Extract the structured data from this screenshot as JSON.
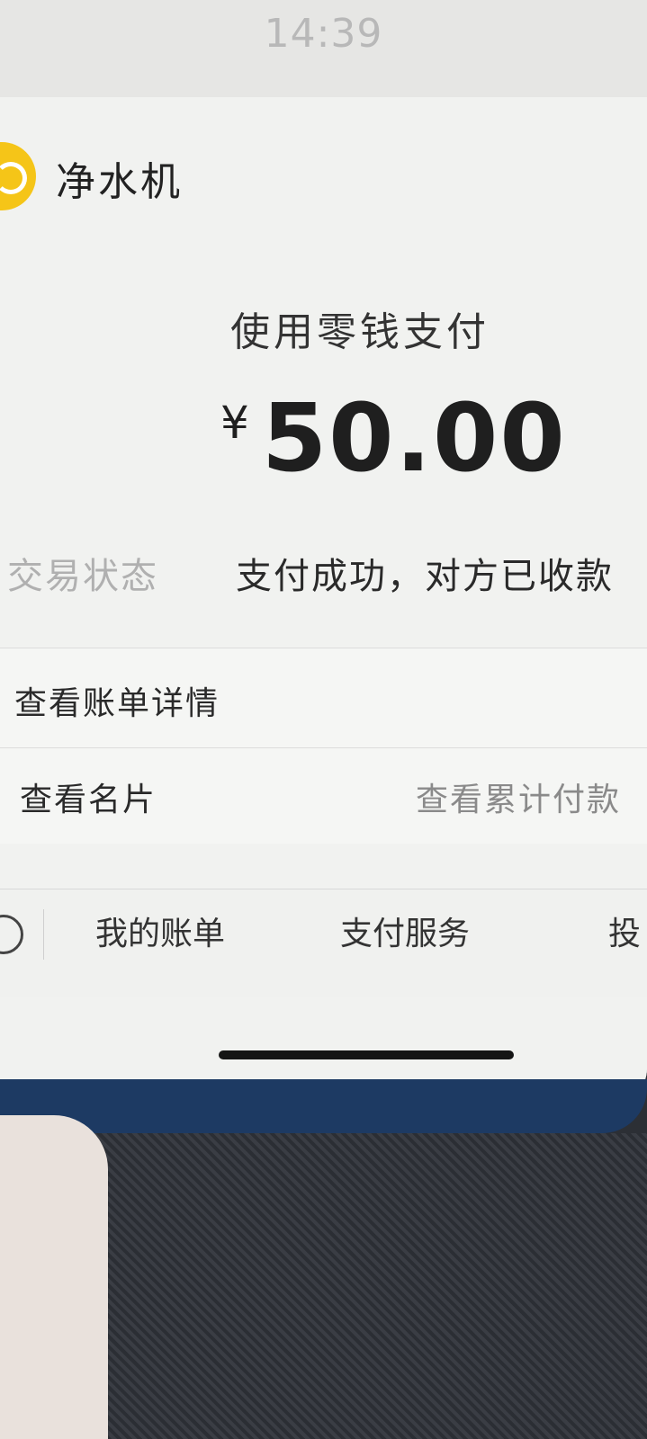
{
  "status_bar": {
    "time": "14:39"
  },
  "merchant": {
    "name": "净水机",
    "logo_icon": "merchant-logo-icon"
  },
  "payment": {
    "method": "使用零钱支付",
    "currency": "¥",
    "amount": "50.00"
  },
  "transaction": {
    "status_label": "交易状态",
    "status_value": "支付成功，对方已收款"
  },
  "actions": {
    "bill_details": "查看账单详情",
    "view_card": "查看名片",
    "cumulative": "查看累计付款"
  },
  "bottom_nav": {
    "items": [
      {
        "label": "我的账单"
      },
      {
        "label": "支付服务"
      },
      {
        "label": "投"
      }
    ]
  }
}
